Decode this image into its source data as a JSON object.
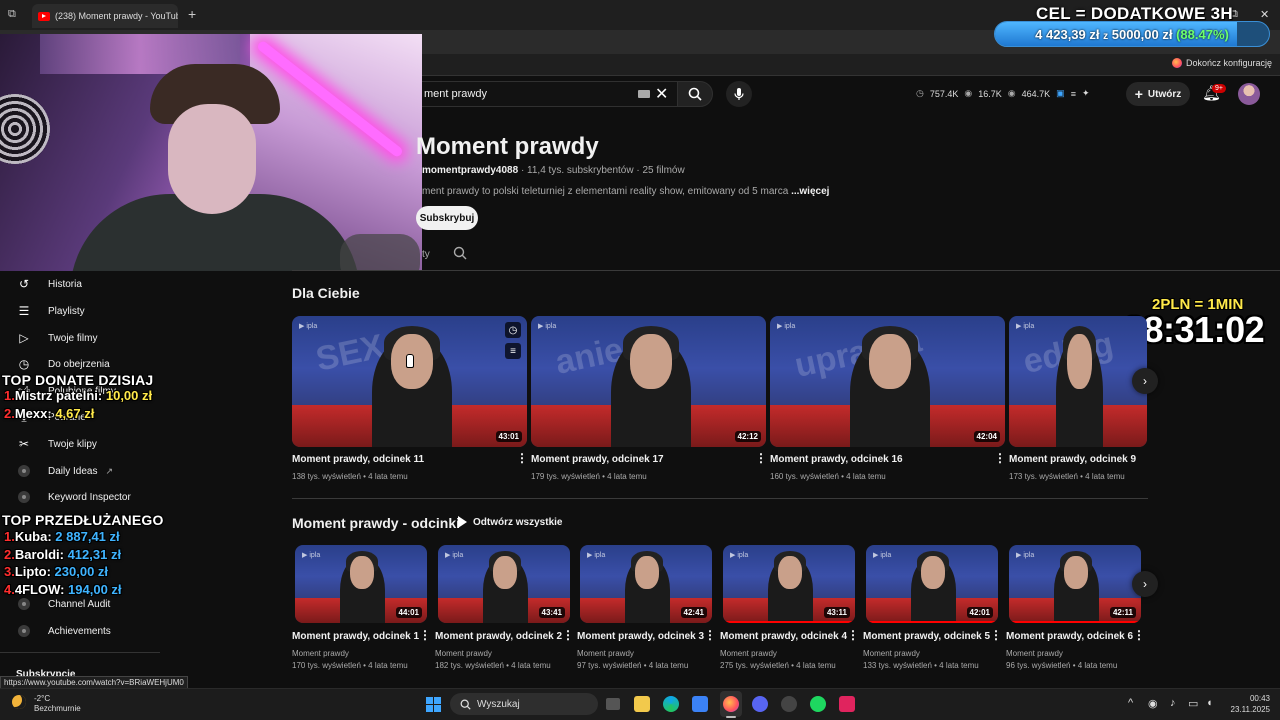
{
  "browser": {
    "tab_title": "(238) Moment prawdy - YouTube",
    "new_tab": "+",
    "bookmark_finish": "Dokończ konfigurację",
    "status_url": "https://www.youtube.com/watch?v=BRiaWEHjUM0"
  },
  "goal": {
    "title": "CEL = DODATKOWE 3H",
    "current": "4 423,39 zł",
    "sep": "z",
    "target": "5000,00 zł",
    "percent_text": "(88.47%)",
    "fraction": 0.8847
  },
  "youtube": {
    "search_value": "ment prawdy",
    "stats": {
      "a": "757.4K",
      "b": "16.7K",
      "c": "464.7K"
    },
    "create_label": "Utwórz",
    "bell_badge": "9+",
    "channel": {
      "title": "Moment prawdy",
      "handle": "momentprawdy4088",
      "subs": "· 11,4 tys. subskrybentów · 25 filmów",
      "desc": "ment prawdy to polski teleturniej z elementami reality show, emitowany od 5 marca",
      "more": "...więcej",
      "subscribe": "Subskrybuj",
      "tab_fragment": "ty"
    }
  },
  "sidebar": {
    "items": [
      {
        "label": "Historia",
        "icon": "history-icon"
      },
      {
        "label": "Playlisty",
        "icon": "playlist-icon"
      },
      {
        "label": "Twoje filmy",
        "icon": "video-icon"
      },
      {
        "label": "Do obejrzenia",
        "icon": "clock-icon"
      },
      {
        "label": "Polubione filmy",
        "icon": "like-icon"
      },
      {
        "label": "Pobrane",
        "icon": "download-icon"
      },
      {
        "label": "Twoje klipy",
        "icon": "scissors-icon"
      },
      {
        "label": "Daily Ideas",
        "icon": "tubebuddy-icon"
      },
      {
        "label": "Keyword Inspector",
        "icon": "tubebuddy-icon"
      },
      {
        "label": "Channel Audit",
        "icon": "tubebuddy-icon"
      },
      {
        "label": "Achievements",
        "icon": "tubebuddy-icon"
      }
    ],
    "subscriptions": "Subskrypcje"
  },
  "overlay": {
    "top_donate_title": "TOP DONATE DZISIAJ",
    "top_donate": [
      {
        "n": "1.",
        "name": "Mistrz patelni:",
        "amt": "10,00 zł"
      },
      {
        "n": "2.",
        "name": "Mexx:",
        "amt": "4,67 zł"
      }
    ],
    "top_ext_title": "TOP PRZEDŁUŻANEGO",
    "top_ext": [
      {
        "n": "1.",
        "name": "Kuba:",
        "amt": "2 887,41 zł"
      },
      {
        "n": "2.",
        "name": "Baroldi:",
        "amt": "412,31 zł"
      },
      {
        "n": "3.",
        "name": "Lipto:",
        "amt": "230,00 zł"
      },
      {
        "n": "4.",
        "name": "4FLOW:",
        "amt": "194,00 zł"
      }
    ],
    "timer_label": "2PLN = 1MIN",
    "timer": "08:31:02"
  },
  "sections": {
    "for_you": {
      "title": "Dla Ciebie",
      "videos": [
        {
          "title": "Moment prawdy, odcinek 11",
          "meta": "138 tys. wyświetleń • 4 lata temu",
          "duration": "43:01",
          "word": "SEX"
        },
        {
          "title": "Moment prawdy, odcinek 17",
          "meta": "179 tys. wyświetleń • 4 lata temu",
          "duration": "42:12",
          "word": "aniem"
        },
        {
          "title": "Moment prawdy, odcinek 16",
          "meta": "160 tys. wyświetleń • 4 lata temu",
          "duration": "42:04",
          "word": "uprawia"
        },
        {
          "title": "Moment prawdy, odcinek 9",
          "meta": "173 tys. wyświetleń • 4 lata temu",
          "duration": "",
          "word": "edług"
        }
      ]
    },
    "episodes": {
      "title": "Moment prawdy - odcinki",
      "play_all": "Odtwórz wszystkie",
      "videos": [
        {
          "title": "Moment prawdy, odcinek 1",
          "channel": "Moment prawdy",
          "meta": "170 tys. wyświetleń • 4 lata temu",
          "duration": "44:01",
          "progress": 0
        },
        {
          "title": "Moment prawdy, odcinek 2",
          "channel": "Moment prawdy",
          "meta": "182 tys. wyświetleń • 4 lata temu",
          "duration": "43:41",
          "progress": 0
        },
        {
          "title": "Moment prawdy, odcinek 3",
          "channel": "Moment prawdy",
          "meta": "97 tys. wyświetleń • 4 lata temu",
          "duration": "42:41",
          "progress": 0
        },
        {
          "title": "Moment prawdy, odcinek 4",
          "channel": "Moment prawdy",
          "meta": "275 tys. wyświetleń • 4 lata temu",
          "duration": "43:11",
          "progress": 1
        },
        {
          "title": "Moment prawdy, odcinek 5",
          "channel": "Moment prawdy",
          "meta": "133 tys. wyświetleń • 4 lata temu",
          "duration": "42:01",
          "progress": 1
        },
        {
          "title": "Moment prawdy, odcinek 6",
          "channel": "Moment prawdy",
          "meta": "96 tys. wyświetleń • 4 lata temu",
          "duration": "42:11",
          "progress": 1
        }
      ]
    }
  },
  "taskbar": {
    "temp": "-2°C",
    "weather": "Bezchmurnie",
    "search": "Wyszukaj",
    "time": "00:43",
    "date": "23.11.2025"
  },
  "colors": {
    "accent": "#ff0000",
    "overlay_yellow": "#ffe94a",
    "overlay_blue": "#3fb4ff",
    "overlay_red": "#ff2e2e"
  }
}
